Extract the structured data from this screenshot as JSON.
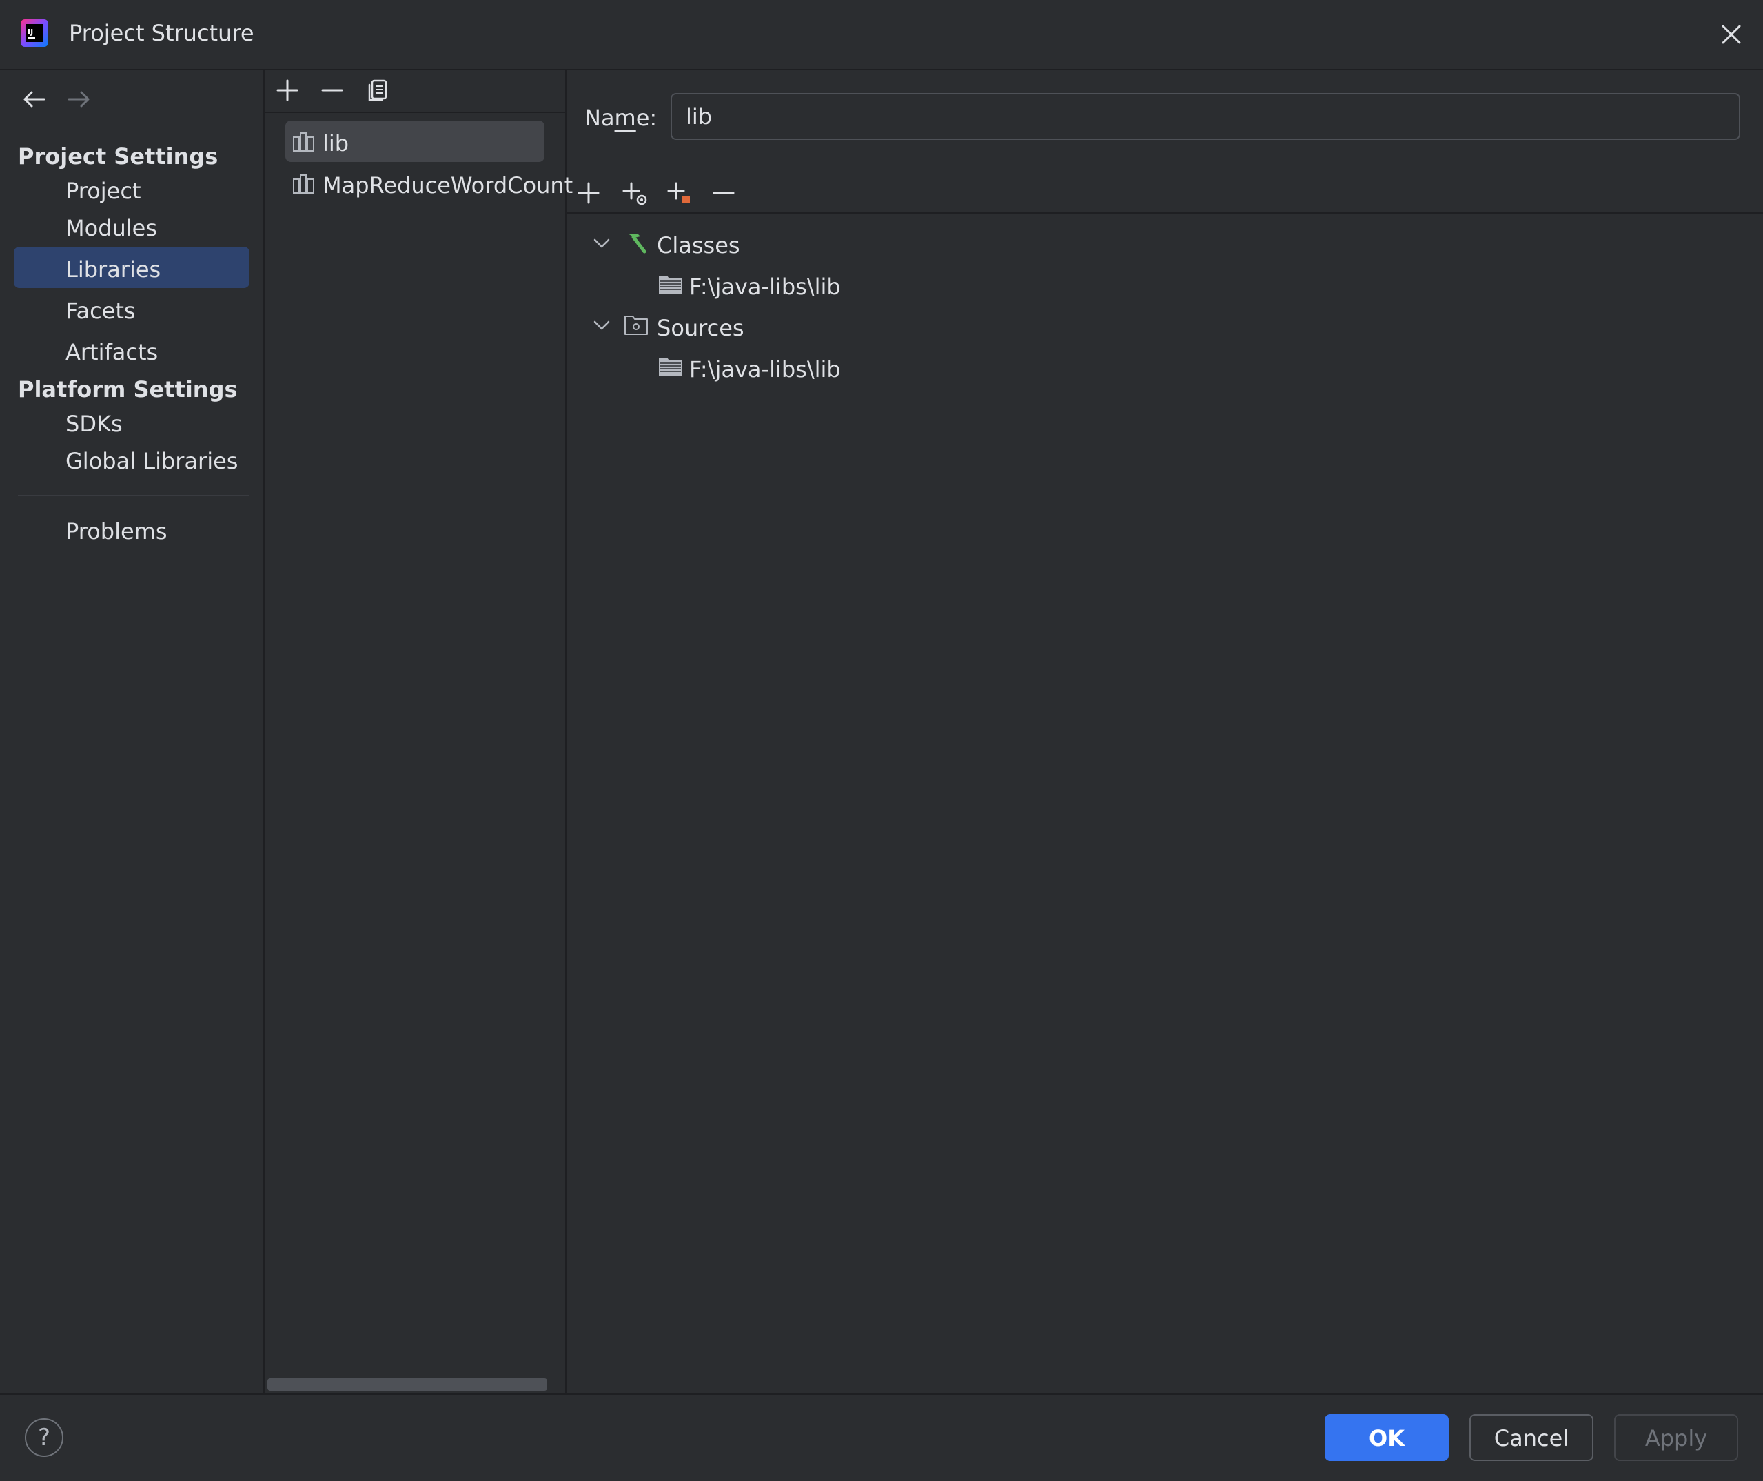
{
  "window": {
    "title": "Project Structure",
    "close_icon": "close-icon",
    "logo_icon": "intellij-idea-logo"
  },
  "nav": {
    "back_icon": "arrow-left-icon",
    "forward_icon": "arrow-right-icon",
    "sections": [
      {
        "title": "Project Settings",
        "items": [
          "Project",
          "Modules",
          "Libraries",
          "Facets",
          "Artifacts"
        ]
      },
      {
        "title": "Platform Settings",
        "items": [
          "SDKs",
          "Global Libraries"
        ]
      }
    ],
    "problems_label": "Problems",
    "selected": "Libraries"
  },
  "libraries": {
    "toolbar": [
      "add-icon",
      "remove-icon",
      "copy-icon"
    ],
    "items": [
      {
        "label": "lib",
        "icon": "library-icon",
        "selected": true
      },
      {
        "label": "MapReduceWordCount",
        "icon": "library-icon",
        "selected": false
      }
    ]
  },
  "detail": {
    "name_label_pre": "Na",
    "name_label_mnemonic": "m",
    "name_label_post": "e:",
    "name_value": "lib",
    "toolbar": [
      "add-icon",
      "add-special-icon",
      "add-with-marker-icon",
      "remove-icon"
    ],
    "tree": [
      {
        "label": "Classes",
        "icon": "hammer-icon",
        "expanded": true,
        "children": [
          {
            "label": "F:\\java-libs\\lib",
            "icon": "jar-folder-icon"
          }
        ]
      },
      {
        "label": "Sources",
        "icon": "source-folder-icon",
        "expanded": true,
        "children": [
          {
            "label": "F:\\java-libs\\lib",
            "icon": "jar-folder-icon"
          }
        ]
      }
    ]
  },
  "footer": {
    "help_label": "?",
    "ok_label": "OK",
    "cancel_label": "Cancel",
    "apply_label": "Apply"
  },
  "colors": {
    "background": "#2b2d30",
    "selection_nav": "#2e436e",
    "selection_list": "#43454a",
    "primary_button": "#3574f0",
    "hammer": "#5fb85f",
    "marker": "#e0693a"
  }
}
